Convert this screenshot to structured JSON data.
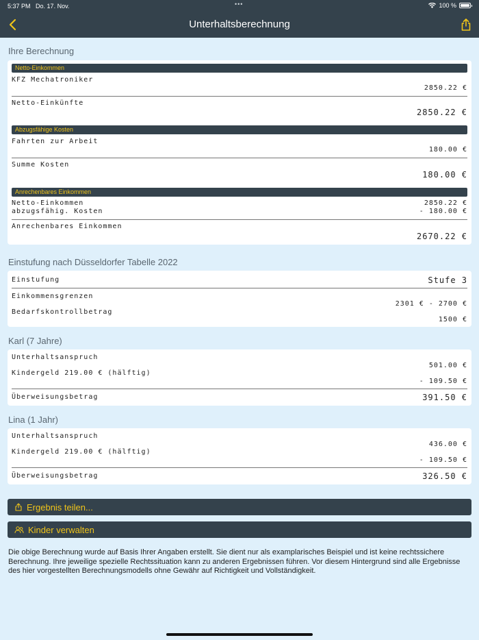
{
  "status": {
    "time": "5:37 PM",
    "date": "Do. 17. Nov.",
    "dots": "•••",
    "battery": "100 %"
  },
  "nav": {
    "title": "Unterhaltsberechnung"
  },
  "calc": {
    "title": "Ihre Berechnung",
    "netto_header": "Netto-Einkommen",
    "job_label": "KFZ Mechatroniker",
    "job_value": "2850.22 €",
    "netto_sum_label": "Netto-Einkünfte",
    "netto_sum_value": "2850.22 €",
    "kosten_header": "Abzugsfähige Kosten",
    "fahrten_label": "Fahrten zur Arbeit",
    "fahrten_value": "180.00 €",
    "kosten_sum_label": "Summe Kosten",
    "kosten_sum_value": "180.00 €",
    "anrech_header": "Anrechenbares Einkommen",
    "netto_label": "Netto-Einkommen",
    "netto_value": "2850.22 €",
    "abz_label": "abzugsfähig. Kosten",
    "abz_value": "- 180.00 €",
    "anrech_label": "Anrechenbares Einkommen",
    "anrech_value": "2670.22 €"
  },
  "einstufung": {
    "title": "Einstufung nach Düsseldorfer Tabelle 2022",
    "stufe_label": "Einstufung",
    "stufe_value": "Stufe 3",
    "grenzen_label": "Einkommensgrenzen",
    "grenzen_value": "2301 € - 2700 €",
    "bedarf_label": "Bedarfskontrollbetrag",
    "bedarf_value": "1500 €"
  },
  "karl": {
    "title": "Karl (7 Jahre)",
    "anspruch_label": "Unterhaltsanspruch",
    "anspruch_value": "501.00 €",
    "kindergeld_label": "Kindergeld 219.00 € (hälftig)",
    "kindergeld_value": "- 109.50 €",
    "betrag_label": "Überweisungsbetrag",
    "betrag_value": "391.50 €"
  },
  "lina": {
    "title": "Lina (1 Jahr)",
    "anspruch_label": "Unterhaltsanspruch",
    "anspruch_value": "436.00 €",
    "kindergeld_label": "Kindergeld 219.00 € (hälftig)",
    "kindergeld_value": "- 109.50 €",
    "betrag_label": "Überweisungsbetrag",
    "betrag_value": "326.50 €"
  },
  "actions": {
    "share": "Ergebnis teilen...",
    "children": "Kinder verwalten"
  },
  "disclaimer": "Die obige Berechnung wurde auf Basis Ihrer Angaben erstellt. Sie dient nur als examplarisches Beispiel und ist keine rechtssichere Berechnung. Ihre jeweilige spezielle Rechtssituation kann zu anderen Ergebnissen führen. Vor diesem Hintergrund sind alle Ergebnisse des hier vorgestellten Berechnungsmodells ohne Gewähr auf Richtigkeit und Vollständigkeit.",
  "colors": {
    "nav": "#34424c",
    "accent": "#f0c419",
    "background": "#dff0fb"
  }
}
